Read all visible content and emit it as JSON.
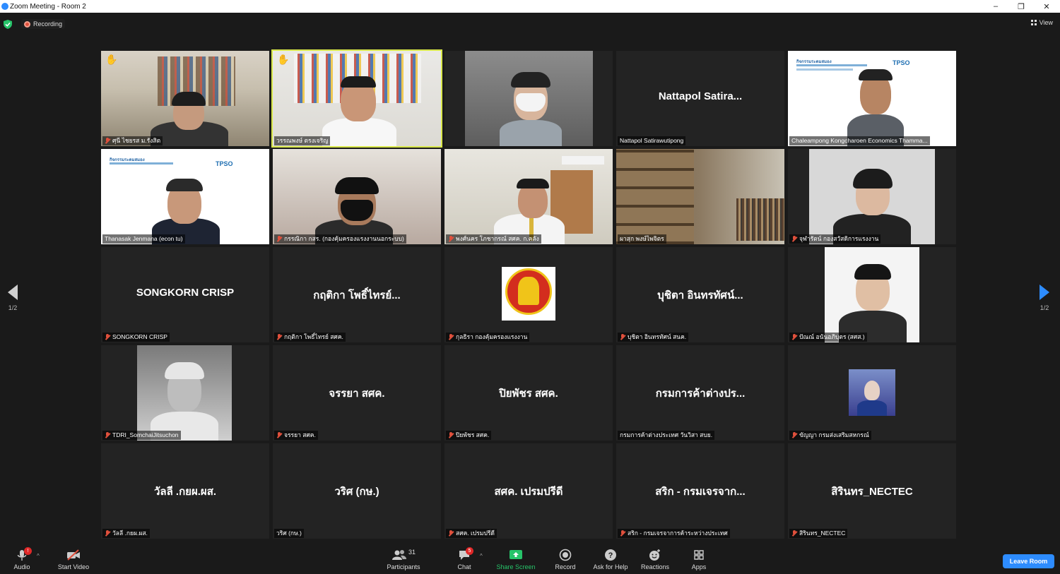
{
  "window": {
    "title": "Zoom Meeting - Room 2",
    "controls": [
      "–",
      "❐",
      "✕"
    ]
  },
  "top": {
    "recording": "Recording",
    "view": "View"
  },
  "pager": {
    "left": "1/2",
    "right": "1/2"
  },
  "tiles": [
    {
      "type": "video",
      "label": "ศุนี ไชยรส ม.รังสิต",
      "muted": true,
      "hand": true
    },
    {
      "type": "video",
      "label": "วรรณพงษ์ ตรงเจริญ",
      "muted": false,
      "hand": true,
      "active": true
    },
    {
      "type": "video",
      "label": "",
      "muted": false
    },
    {
      "type": "name",
      "big": "Nattapol Satira...",
      "label": "Nattapol Satirawutipong",
      "muted": false
    },
    {
      "type": "video",
      "label": "Chaleampong Kongcharoen Economics Thamma...",
      "muted": false
    },
    {
      "type": "video",
      "label": "Thanasak Jenmana (econ tu)",
      "muted": false
    },
    {
      "type": "video",
      "label": "กรรณิกา กสร. (กองคุ้มครองแรงงานนอกระบบ)",
      "muted": true
    },
    {
      "type": "video",
      "label": "พงศ์นคร โภชากรณ์ สศค. ก.คลัง",
      "muted": true
    },
    {
      "type": "video",
      "label": "ผาสุก พงษ์ไพจิตร",
      "muted": false
    },
    {
      "type": "video",
      "label": "จุฬารัตน์ กองสวัสดิการแรงงาน",
      "muted": true
    },
    {
      "type": "name",
      "big": "SONGKORN CRISP",
      "label": "SONGKORN CRISP",
      "muted": true
    },
    {
      "type": "name",
      "big": "กฤติกา โพธิ์ไทรย์...",
      "label": "กฤติกา โพธิ์ไทรย์ สศค.",
      "muted": true
    },
    {
      "type": "logo",
      "label": "กุลธิรา กองคุ้มครองแรงงาน",
      "muted": true
    },
    {
      "type": "name",
      "big": "บุชิตา อินทรทัศน์...",
      "label": "บุชิตา อินทรทัศน์ สนค.",
      "muted": true
    },
    {
      "type": "photo",
      "label": "ปัณณ์ อนันอภิบุตร (สศส.)",
      "muted": true
    },
    {
      "type": "photo",
      "label": "TDRI_SomchaiJitsuchon",
      "muted": true
    },
    {
      "type": "name",
      "big": "จรรยา สศค.",
      "label": "จรรยา สศค.",
      "muted": true
    },
    {
      "type": "name",
      "big": "ปิยพัชร สศค.",
      "label": "ปิยพัชร สศค.",
      "muted": true
    },
    {
      "type": "name",
      "big": "กรมการค้าต่างปร...",
      "label": "กรมการค้าต่างประเทศ วันวิสา สบย.",
      "muted": false
    },
    {
      "type": "photo",
      "label": "ขัญญา กรมส่งเสริมสหกรณ์",
      "muted": true
    },
    {
      "type": "name",
      "big": "วัลลี .กยผ.ผส.",
      "label": "วัลลี .กยผ.ผส.",
      "muted": true
    },
    {
      "type": "name",
      "big": "วริศ (กษ.)",
      "label": "วริศ (กษ.)",
      "muted": false
    },
    {
      "type": "name",
      "big": "สศค. เปรมปรีดี",
      "label": "สศค. เปรมปรีดี",
      "muted": true
    },
    {
      "type": "name",
      "big": "สริก - กรมเจรจาก...",
      "label": "สริก - กรมเจรจาการค้าระหว่างประเทศ",
      "muted": true
    },
    {
      "type": "name",
      "big": "สิรินทร_NECTEC",
      "label": "สิรินทร_NECTEC",
      "muted": true
    }
  ],
  "slide": {
    "heading": "กิจกรรมระดมสมอง",
    "brand": "TPSO"
  },
  "toolbar": {
    "audio": "Audio",
    "video": "Start Video",
    "participants": "Participants",
    "participants_count": "31",
    "chat": "Chat",
    "chat_badge": "5",
    "audio_badge": "!",
    "share": "Share Screen",
    "record": "Record",
    "help": "Ask for Help",
    "reactions": "Reactions",
    "apps": "Apps",
    "leave": "Leave Room"
  },
  "colors": {
    "accent": "#2d8cff",
    "share": "#27c46a",
    "muted": "#e0503c",
    "active_border": "#d9e84a"
  }
}
